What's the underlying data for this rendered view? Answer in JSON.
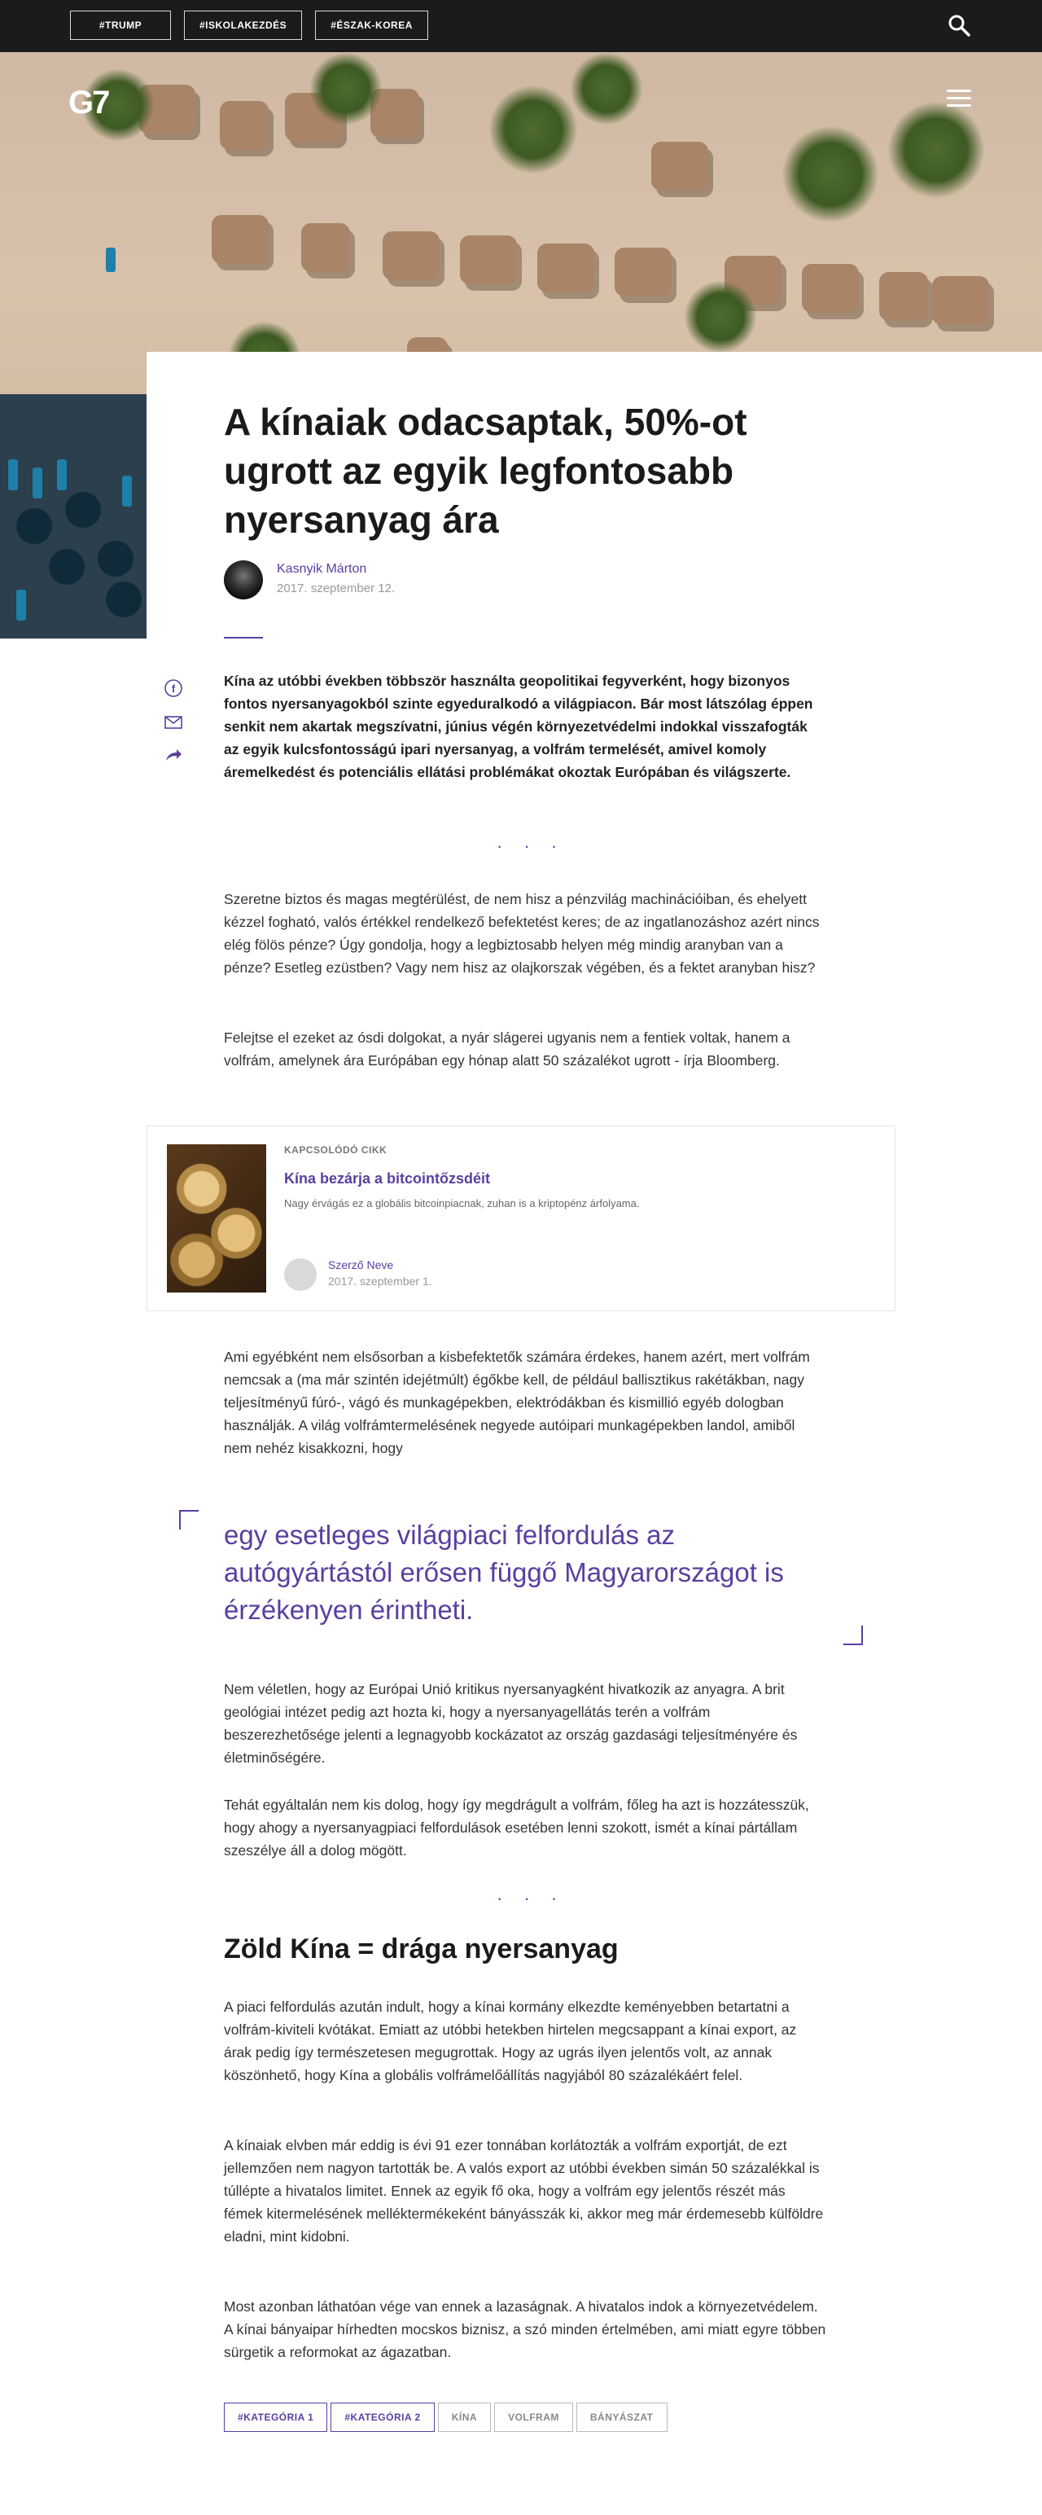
{
  "topbar": {
    "tags": [
      "#TRUMP",
      "#ISKOLAKEZDÉS",
      "#ÉSZAK-KOREA"
    ]
  },
  "brand": {
    "logo": "G7"
  },
  "article": {
    "title": "A kínaiak odacsaptak, 50%-ot ugrott az egyik legfontosabb nyersanyag ára",
    "author": "Kasnyik Márton",
    "date": "2017. szeptember 12.",
    "lead": "Kína az utóbbi években többször használta geopolitikai fegyverként, hogy bizonyos fontos nyersanyagokból szinte egyeduralkodó a világpiacon. Bár most látszólag éppen senkit nem akartak megszívatni, június végén környezetvédelmi indokkal visszafogták az egyik kulcsfontosságú ipari nyersanyag, a volfrám termelését, amivel komoly áremelkedést és potenciális ellátási problémákat okoztak Európában és világszerte.",
    "separator": "· · ·",
    "p1": "Szeretne biztos és magas megtérülést, de nem hisz a pénzvilág machinációiban, és ehelyett kézzel fogható, valós értékkel rendelkező befektetést keres; de az ingatlanozáshoz azért nincs elég fölös pénze? Úgy gondolja, hogy a legbiztosabb helyen még mindig aranyban van a pénze? Esetleg ezüstben? Vagy nem hisz az olajkorszak végében, és a fektet aranyban hisz?",
    "p2": "Felejtse el ezeket az ósdi dolgokat, a nyár slágerei ugyanis nem a fentiek voltak, hanem a volfrám, amelynek ára Európában egy hónap alatt 50 százalékot ugrott - írja Bloomberg.",
    "related": {
      "kicker": "KAPCSOLÓDÓ CIKK",
      "title": "Kína bezárja a bitcointőzsdéit",
      "desc": "Nagy érvágás ez a globális bitcoinpiacnak, zuhan is a kriptopénz árfolyama.",
      "author": "Szerző Neve",
      "date": "2017. szeptember 1."
    },
    "p3": "Ami egyébként nem elsősorban a kisbefektetők számára érdekes, hanem azért, mert volfrám nemcsak a (ma már szintén idejétmúlt) égőkbe kell, de például ballisztikus rakétákban, nagy teljesítményű fúró-, vágó és munkagépekben, elektródákban és kismillió egyéb dologban használják. A világ volfrámtermelésének negyede autóipari munkagépekben landol, amiből nem nehéz kisakkozni, hogy",
    "quote": "egy esetleges világpiaci felfordulás az autógyártástól erősen függő Magyarországot is érzékenyen érintheti.",
    "p4": "Nem véletlen, hogy az Európai Unió kritikus nyersanyagként hivatkozik az anyagra. A brit geológiai intézet pedig azt hozta ki, hogy a nyersanyagellátás terén a volfrám beszerezhetősége jelenti a legnagyobb kockázatot az ország gazdasági teljesítményére és életminőségére.",
    "p5": "Tehát egyáltalán nem kis dolog, hogy így megdrágult a volfrám, főleg ha azt is hozzátesszük, hogy ahogy a nyersanyagpiaci felfordulások esetében lenni szokott, ismét a kínai pártállam szeszélye áll a dolog mögött.",
    "h2": "Zöld Kína = drága nyersanyag",
    "p6": "A piaci felfordulás azután indult, hogy a kínai kormány elkezdte keményebben betartatni a volfrám-kiviteli kvótákat. Emiatt az utóbbi hetekben hirtelen megcsappant a kínai export, az árak pedig így természetesen megugrottak. Hogy az ugrás ilyen jelentős volt, az annak köszönhető, hogy Kína a globális volfrámelőállítás nagyjából 80 százalékáért felel.",
    "p7": "A kínaiak elvben már eddig is évi 91 ezer tonnában korlátozták a volfrám exportját, de ezt jellemzően nem nagyon tartották be. A valós export az utóbbi években simán 50 százalékkal is túllépte a hivatalos limitet. Ennek az egyik fő oka, hogy a volfrám egy jelentős részét más fémek kitermelésének melléktermékeként bányásszák ki, akkor meg már érdemesebb külföldre eladni, mint kidobni.",
    "p8": "Most azonban láthatóan vége van ennek a lazaságnak. A hivatalos indok a környezetvédelem. A kínai bányaipar hírhedten mocskos biznisz, a szó minden értelmében, ami miatt egyre többen sürgetik a reformokat az ágazatban.",
    "tags": [
      "#KATEGÓRIA 1",
      "#KATEGÓRIA 2",
      "KÍNA",
      "VOLFRAM",
      "BÁNYÁSZAT"
    ]
  },
  "colors": {
    "accent": "#5a3fa0",
    "topbar": "#1b1b1b"
  }
}
